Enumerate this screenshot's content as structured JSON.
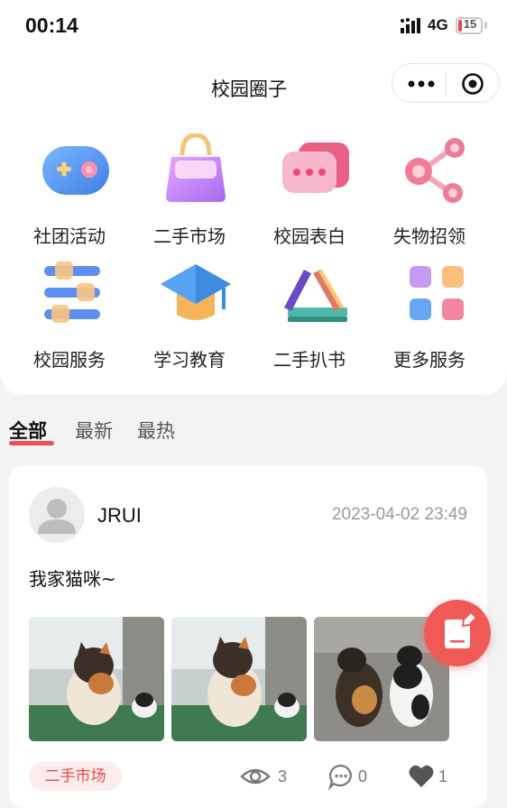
{
  "status_bar": {
    "time": "00:14",
    "network": "4G",
    "battery": "15",
    "battery_level": 0.15,
    "battery_color": "#e8474a"
  },
  "header": {
    "title": "校园圈子",
    "capsule_more_icon": "more-dots-icon",
    "capsule_close_icon": "target-close-icon"
  },
  "grid": [
    {
      "label": "社团活动",
      "icon": "gamepad-icon"
    },
    {
      "label": "二手市场",
      "icon": "handbag-icon"
    },
    {
      "label": "校园表白",
      "icon": "chat-bubble-icon"
    },
    {
      "label": "失物招领",
      "icon": "share-nodes-icon"
    },
    {
      "label": "校园服务",
      "icon": "sliders-icon"
    },
    {
      "label": "学习教育",
      "icon": "graduation-cap-icon"
    },
    {
      "label": "二手扒书",
      "icon": "books-icon"
    },
    {
      "label": "更多服务",
      "icon": "apps-grid-icon"
    }
  ],
  "tabs": [
    {
      "label": "全部",
      "active": true
    },
    {
      "label": "最新",
      "active": false
    },
    {
      "label": "最热",
      "active": false
    }
  ],
  "post": {
    "username": "JRUI",
    "time": "2023-04-02 23:49",
    "text": "我家猫咪~",
    "tag": "二手市场",
    "views": "3",
    "comments": "0",
    "likes": "1"
  },
  "colors": {
    "accent": "#ef4f4a",
    "tag_bg": "#fdecec",
    "fab": "#ef5a56"
  }
}
